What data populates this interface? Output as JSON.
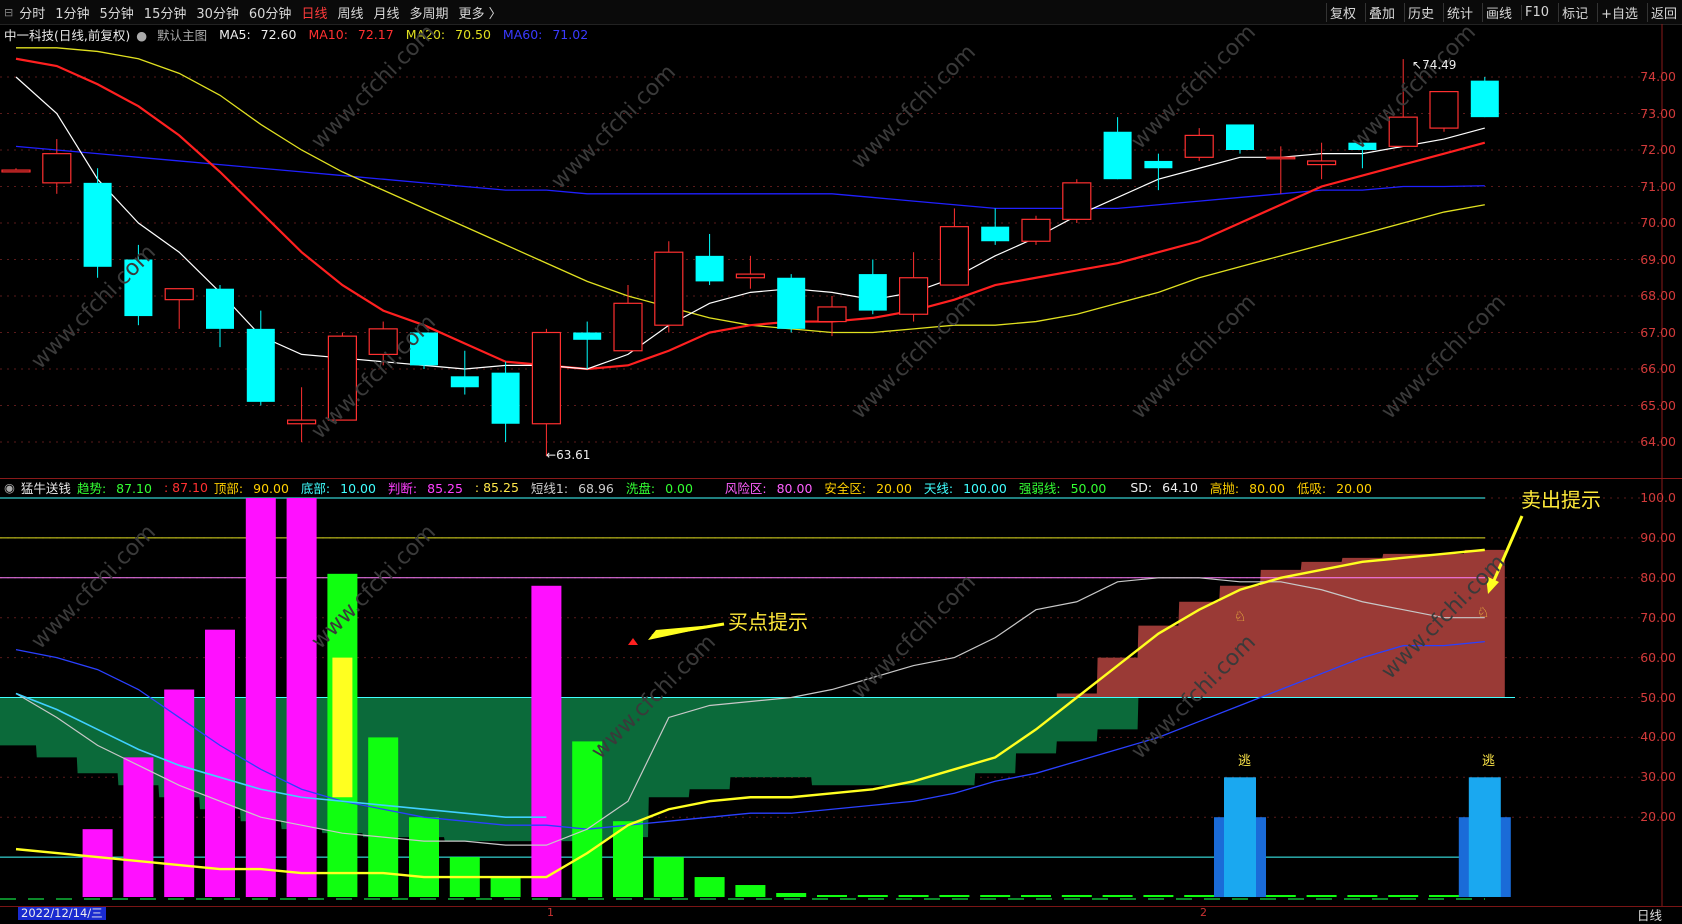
{
  "toolbar": {
    "periods": [
      "分时",
      "1分钟",
      "5分钟",
      "15分钟",
      "30分钟",
      "60分钟",
      "日线",
      "周线",
      "月线",
      "多周期",
      "更多 〉"
    ],
    "active_period": "日线",
    "tools": [
      "复权",
      "叠加",
      "历史",
      "统计",
      "画线",
      "F10",
      "标记",
      "+自选",
      "返回"
    ]
  },
  "main_info": {
    "stock": "中一科技(日线,前复权)",
    "template": "默认主图",
    "ma5_label": "MA5:",
    "ma5": "72.60",
    "ma10_label": "MA10:",
    "ma10": "72.17",
    "ma20_label": "MA20:",
    "ma20": "70.50",
    "ma60_label": "MA60:",
    "ma60": "71.02"
  },
  "ind_info": {
    "name": "猛牛送钱",
    "trend_label": "趋势:",
    "trend": "87.10",
    "trend2": ": 87.10",
    "top_label": "顶部:",
    "top": "90.00",
    "bottom_label": "底部:",
    "bottom": "10.00",
    "judge_label": "判断:",
    "judge": "85.25",
    "judge2": ": 85.25",
    "short_label": "短线1:",
    "short": "68.96",
    "wash_label": "洗盘:",
    "wash": "0.00",
    "risk_label": "风险区:",
    "risk": "80.00",
    "safe_label": "安全区:",
    "safe": "20.00",
    "sky_label": "天线:",
    "sky": "100.00",
    "strong_label": "强弱线:",
    "strong": "50.00",
    "sd_label": "SD:",
    "sd": "64.10",
    "sell_label": "高抛:",
    "sell": "80.00",
    "buy_label": "低吸:",
    "buy": "20.00"
  },
  "price_axis": [
    "74.00",
    "73.00",
    "72.00",
    "71.00",
    "70.00",
    "69.00",
    "68.00",
    "67.00",
    "66.00",
    "65.00",
    "64.00"
  ],
  "ind_axis": [
    "100.0",
    "90.00",
    "80.00",
    "70.00",
    "60.00",
    "50.00",
    "40.00",
    "30.00",
    "20.00"
  ],
  "high_mark": "74.49",
  "low_mark": "63.61",
  "annotations": {
    "buy": "买点提示",
    "sell": "卖出提示",
    "escape": "逃"
  },
  "x_ticks": [
    "1",
    "2"
  ],
  "date_tag": "2022/12/14/三",
  "period_label": "日线",
  "watermark": "www.cfchi.com",
  "colors": {
    "up": "#ff3030",
    "down": "#00ffff",
    "ma5": "#ffffff",
    "ma10": "#ff2020",
    "ma20": "#e0e020",
    "ma60": "#2020ff"
  },
  "chart_data": {
    "type": "candlestick",
    "candles": [
      {
        "o": 71.4,
        "h": 71.5,
        "l": 71.4,
        "c": 71.45
      },
      {
        "o": 71.1,
        "h": 72.3,
        "l": 70.8,
        "c": 71.9
      },
      {
        "o": 71.1,
        "h": 71.5,
        "l": 68.5,
        "c": 68.8
      },
      {
        "o": 69.0,
        "h": 69.4,
        "l": 67.2,
        "c": 67.45
      },
      {
        "o": 67.9,
        "h": 68.2,
        "l": 67.1,
        "c": 68.2
      },
      {
        "o": 68.2,
        "h": 68.3,
        "l": 66.6,
        "c": 67.1
      },
      {
        "o": 67.1,
        "h": 67.6,
        "l": 65.0,
        "c": 65.1
      },
      {
        "o": 64.5,
        "h": 65.5,
        "l": 64.0,
        "c": 64.6
      },
      {
        "o": 64.6,
        "h": 67.0,
        "l": 64.6,
        "c": 66.9
      },
      {
        "o": 66.4,
        "h": 67.3,
        "l": 66.1,
        "c": 67.1
      },
      {
        "o": 67.0,
        "h": 67.0,
        "l": 66.0,
        "c": 66.1
      },
      {
        "o": 65.8,
        "h": 66.5,
        "l": 65.3,
        "c": 65.5
      },
      {
        "o": 65.9,
        "h": 66.2,
        "l": 64.0,
        "c": 64.5
      },
      {
        "o": 64.5,
        "h": 67.1,
        "l": 63.61,
        "c": 67.0
      },
      {
        "o": 67.0,
        "h": 67.3,
        "l": 66.0,
        "c": 66.8
      },
      {
        "o": 66.5,
        "h": 68.3,
        "l": 66.5,
        "c": 67.8
      },
      {
        "o": 67.2,
        "h": 69.5,
        "l": 67.0,
        "c": 69.2
      },
      {
        "o": 69.1,
        "h": 69.7,
        "l": 68.3,
        "c": 68.4
      },
      {
        "o": 68.5,
        "h": 69.1,
        "l": 68.2,
        "c": 68.6
      },
      {
        "o": 68.5,
        "h": 68.6,
        "l": 67.0,
        "c": 67.1
      },
      {
        "o": 67.3,
        "h": 68.0,
        "l": 66.9,
        "c": 67.7
      },
      {
        "o": 68.6,
        "h": 69.0,
        "l": 67.5,
        "c": 67.6
      },
      {
        "o": 67.5,
        "h": 69.2,
        "l": 67.3,
        "c": 68.5
      },
      {
        "o": 68.3,
        "h": 70.4,
        "l": 68.3,
        "c": 69.9
      },
      {
        "o": 69.9,
        "h": 70.4,
        "l": 69.4,
        "c": 69.5
      },
      {
        "o": 69.5,
        "h": 70.2,
        "l": 69.4,
        "c": 70.1
      },
      {
        "o": 70.1,
        "h": 71.2,
        "l": 70.0,
        "c": 71.1
      },
      {
        "o": 72.5,
        "h": 72.9,
        "l": 71.2,
        "c": 71.2
      },
      {
        "o": 71.7,
        "h": 71.9,
        "l": 70.9,
        "c": 71.5
      },
      {
        "o": 71.8,
        "h": 72.6,
        "l": 71.7,
        "c": 72.4
      },
      {
        "o": 72.7,
        "h": 72.7,
        "l": 71.9,
        "c": 72.0
      },
      {
        "o": 71.8,
        "h": 72.1,
        "l": 70.8,
        "c": 71.8
      },
      {
        "o": 71.6,
        "h": 72.2,
        "l": 71.2,
        "c": 71.7
      },
      {
        "o": 72.2,
        "h": 72.2,
        "l": 71.5,
        "c": 72.0
      },
      {
        "o": 72.1,
        "h": 74.49,
        "l": 72.1,
        "c": 72.9
      },
      {
        "o": 72.6,
        "h": 73.6,
        "l": 72.5,
        "c": 73.6
      },
      {
        "o": 73.9,
        "h": 74.0,
        "l": 72.9,
        "c": 72.9
      }
    ],
    "ma5": [
      74.0,
      73.0,
      71.2,
      70.0,
      69.2,
      68.1,
      66.9,
      66.4,
      66.3,
      66.2,
      66.1,
      66.0,
      66.1,
      66.1,
      66.0,
      66.4,
      67.2,
      67.8,
      68.1,
      68.2,
      68.1,
      67.9,
      68.1,
      68.5,
      69.1,
      69.6,
      70.2,
      70.7,
      71.2,
      71.5,
      71.8,
      71.8,
      71.9,
      71.9,
      72.1,
      72.3,
      72.6
    ],
    "ma10": [
      74.5,
      74.3,
      73.8,
      73.2,
      72.4,
      71.4,
      70.3,
      69.2,
      68.3,
      67.6,
      67.2,
      66.7,
      66.2,
      66.1,
      66.0,
      66.1,
      66.5,
      67.0,
      67.2,
      67.3,
      67.3,
      67.4,
      67.6,
      67.9,
      68.3,
      68.5,
      68.7,
      68.9,
      69.2,
      69.5,
      70.0,
      70.5,
      71.0,
      71.3,
      71.6,
      71.9,
      72.2
    ],
    "ma20": [
      74.8,
      74.8,
      74.7,
      74.5,
      74.1,
      73.5,
      72.7,
      72.0,
      71.4,
      70.9,
      70.4,
      69.9,
      69.4,
      68.9,
      68.4,
      68.0,
      67.7,
      67.4,
      67.2,
      67.1,
      67.0,
      67.0,
      67.1,
      67.2,
      67.2,
      67.3,
      67.5,
      67.8,
      68.1,
      68.5,
      68.8,
      69.1,
      69.4,
      69.7,
      70.0,
      70.3,
      70.5
    ],
    "ma60": [
      72.1,
      72.0,
      71.9,
      71.8,
      71.7,
      71.6,
      71.5,
      71.4,
      71.3,
      71.2,
      71.1,
      71.0,
      70.9,
      70.9,
      70.8,
      70.8,
      70.8,
      70.8,
      70.8,
      70.8,
      70.8,
      70.7,
      70.6,
      70.5,
      70.4,
      70.4,
      70.4,
      70.4,
      70.5,
      70.6,
      70.7,
      70.8,
      70.9,
      70.9,
      71.0,
      71.0,
      71.02
    ],
    "indicator": {
      "magenta_bars": [
        0,
        0,
        17,
        35,
        52,
        67,
        100,
        100,
        0,
        0,
        0,
        0,
        0,
        78,
        0,
        0,
        0,
        0,
        0,
        0,
        0,
        0,
        0,
        0,
        0,
        0,
        0,
        0,
        0,
        0,
        0,
        0,
        0,
        0,
        0,
        0,
        0
      ],
      "green_bars": [
        0,
        0,
        0,
        0,
        0,
        0,
        0,
        0,
        81,
        40,
        20,
        10,
        5,
        0,
        39,
        19,
        10,
        5,
        3,
        1,
        0.5,
        0.5,
        0.5,
        0.5,
        0.5,
        0.5,
        0.5,
        0.5,
        0.5,
        0.5,
        0.5,
        0.5,
        0.5,
        0.5,
        0.5,
        0.5,
        0.5
      ],
      "yellow_box": [
        25,
        60
      ],
      "dark_area_bottom": [
        38,
        35,
        31,
        28,
        25,
        22,
        19,
        17,
        16,
        15,
        15,
        14,
        14,
        14,
        14,
        15,
        25,
        27,
        30,
        30,
        28,
        28,
        28,
        28,
        31,
        36,
        39,
        42,
        50,
        50,
        50,
        50,
        50,
        50,
        50,
        50,
        50
      ],
      "red_area_top": [
        0,
        0,
        0,
        0,
        0,
        0,
        0,
        0,
        0,
        0,
        0,
        0,
        0,
        0,
        0,
        0,
        0,
        0,
        0,
        0,
        0,
        0,
        0,
        0,
        0,
        0,
        51,
        60,
        68,
        74,
        78,
        82,
        84,
        85,
        86,
        86,
        87
      ],
      "trend": [
        12,
        11,
        10,
        9,
        8,
        7,
        7,
        6,
        6,
        6,
        5,
        5,
        5,
        5,
        11,
        18,
        22,
        24,
        25,
        25,
        26,
        27,
        29,
        32,
        35,
        42,
        50,
        58,
        66,
        72,
        77,
        80,
        82,
        84,
        85,
        86,
        87
      ],
      "judge": [
        51,
        45,
        38,
        33,
        28,
        24,
        20,
        18,
        16,
        15,
        14,
        14,
        13,
        13,
        17,
        24,
        45,
        48,
        49,
        50,
        52,
        55,
        58,
        60,
        65,
        72,
        74,
        79,
        80,
        80,
        79,
        79,
        77,
        74,
        72,
        70,
        70
      ],
      "blue_line": [
        62,
        60,
        57,
        52,
        45,
        38,
        32,
        27,
        24,
        22,
        20,
        19,
        18,
        18,
        17,
        18,
        19,
        20,
        21,
        21,
        22,
        23,
        24,
        26,
        29,
        31,
        34,
        37,
        40,
        44,
        48,
        52,
        56,
        60,
        63,
        63,
        64
      ],
      "escape_bars": [
        0,
        0,
        0,
        0,
        0,
        0,
        0,
        0,
        0,
        0,
        0,
        0,
        0,
        0,
        0,
        0,
        0,
        0,
        0,
        0,
        0,
        0,
        0,
        0,
        0,
        0,
        0,
        0,
        0,
        0,
        30,
        0,
        0,
        0,
        0,
        0,
        30
      ]
    }
  }
}
